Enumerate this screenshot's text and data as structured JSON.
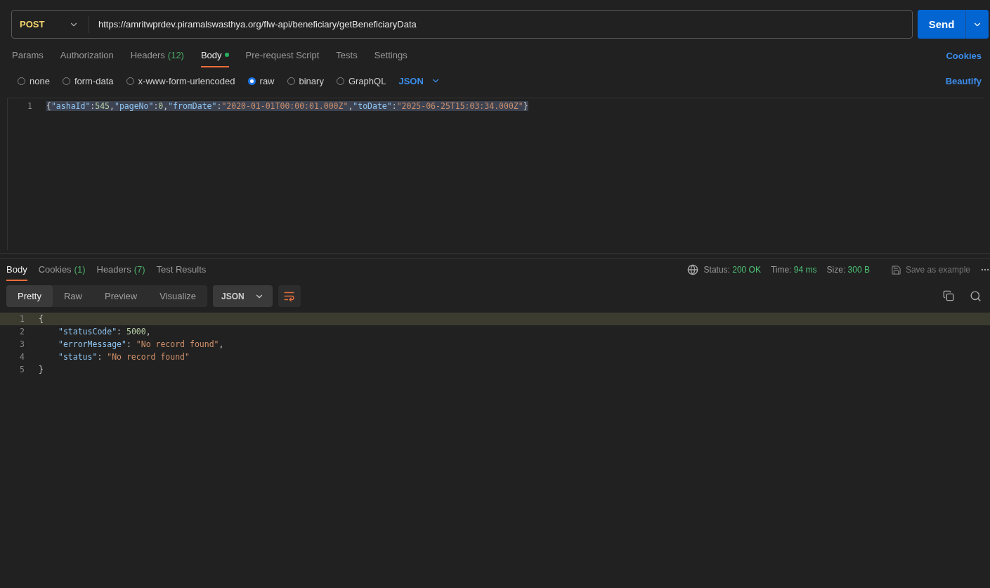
{
  "request": {
    "method": "POST",
    "url": "https://amritwprdev.piramalswasthya.org/flw-api/beneficiary/getBeneficiaryData",
    "send": "Send"
  },
  "request_tabs": [
    {
      "label": "Params",
      "selected": false
    },
    {
      "label": "Authorization",
      "selected": false
    },
    {
      "label": "Headers",
      "count": "(12)",
      "selected": false
    },
    {
      "label": "Body",
      "selected": true,
      "dot": true
    },
    {
      "label": "Pre-request Script",
      "selected": false
    },
    {
      "label": "Tests",
      "selected": false
    },
    {
      "label": "Settings",
      "selected": false
    }
  ],
  "cookies_link": "Cookies",
  "body_types": [
    {
      "label": "none",
      "selected": false
    },
    {
      "label": "form-data",
      "selected": false
    },
    {
      "label": "x-www-form-urlencoded",
      "selected": false
    },
    {
      "label": "raw",
      "selected": true
    },
    {
      "label": "binary",
      "selected": false
    },
    {
      "label": "GraphQL",
      "selected": false
    }
  ],
  "body_format": "JSON",
  "beautify": "Beautify",
  "request_body": [
    {
      "number": "1",
      "indented": false,
      "highlighted": true,
      "tokens": [
        {
          "kind": "punct",
          "text": "{"
        },
        {
          "kind": "key",
          "text": "\"ashaId\""
        },
        {
          "kind": "punct",
          "text": ":"
        },
        {
          "kind": "number",
          "text": "545"
        },
        {
          "kind": "punct",
          "text": ","
        },
        {
          "kind": "key",
          "text": "\"pageNo\""
        },
        {
          "kind": "punct",
          "text": ":"
        },
        {
          "kind": "number",
          "text": "0"
        },
        {
          "kind": "punct",
          "text": ","
        },
        {
          "kind": "key",
          "text": "\"fromDate\""
        },
        {
          "kind": "punct",
          "text": ":"
        },
        {
          "kind": "string",
          "text": "\"2020-01-01T00:00:01.000Z\""
        },
        {
          "kind": "punct",
          "text": ","
        },
        {
          "kind": "key",
          "text": "\"toDate\""
        },
        {
          "kind": "punct",
          "text": ":"
        },
        {
          "kind": "string",
          "text": "\"2025-06-25T15:03:34.000Z\""
        },
        {
          "kind": "punct",
          "text": "}"
        }
      ]
    }
  ],
  "response_tabs": [
    {
      "label": "Body",
      "selected": true
    },
    {
      "label": "Cookies",
      "count": "(1)",
      "selected": false
    },
    {
      "label": "Headers",
      "count": "(7)",
      "selected": false
    },
    {
      "label": "Test Results",
      "selected": false
    }
  ],
  "response_meta": [
    {
      "label": "Status:",
      "value": "200 OK"
    },
    {
      "label": "Time:",
      "value": "94 ms"
    },
    {
      "label": "Size:",
      "value": "300 B"
    }
  ],
  "save_example": "Save as example",
  "view_modes": [
    {
      "label": "Pretty",
      "selected": true
    },
    {
      "label": "Raw",
      "selected": false
    },
    {
      "label": "Preview",
      "selected": false
    },
    {
      "label": "Visualize",
      "selected": false
    }
  ],
  "response_format": "JSON",
  "response_body": [
    {
      "number": "1",
      "indented": false,
      "highlighted": true,
      "tokens": [
        {
          "kind": "punct",
          "text": "{"
        }
      ]
    },
    {
      "number": "2",
      "indented": true,
      "highlighted": false,
      "tokens": [
        {
          "kind": "key",
          "text": "\"statusCode\""
        },
        {
          "kind": "punct",
          "text": ": "
        },
        {
          "kind": "number",
          "text": "5000"
        },
        {
          "kind": "punct",
          "text": ","
        }
      ]
    },
    {
      "number": "3",
      "indented": true,
      "highlighted": false,
      "tokens": [
        {
          "kind": "key",
          "text": "\"errorMessage\""
        },
        {
          "kind": "punct",
          "text": ": "
        },
        {
          "kind": "string",
          "text": "\"No record found\""
        },
        {
          "kind": "punct",
          "text": ","
        }
      ]
    },
    {
      "number": "4",
      "indented": true,
      "highlighted": false,
      "tokens": [
        {
          "kind": "key",
          "text": "\"status\""
        },
        {
          "kind": "punct",
          "text": ": "
        },
        {
          "kind": "string",
          "text": "\"No record found\""
        }
      ]
    },
    {
      "number": "5",
      "indented": false,
      "highlighted": false,
      "tokens": [
        {
          "kind": "punct",
          "text": "}"
        }
      ]
    }
  ]
}
